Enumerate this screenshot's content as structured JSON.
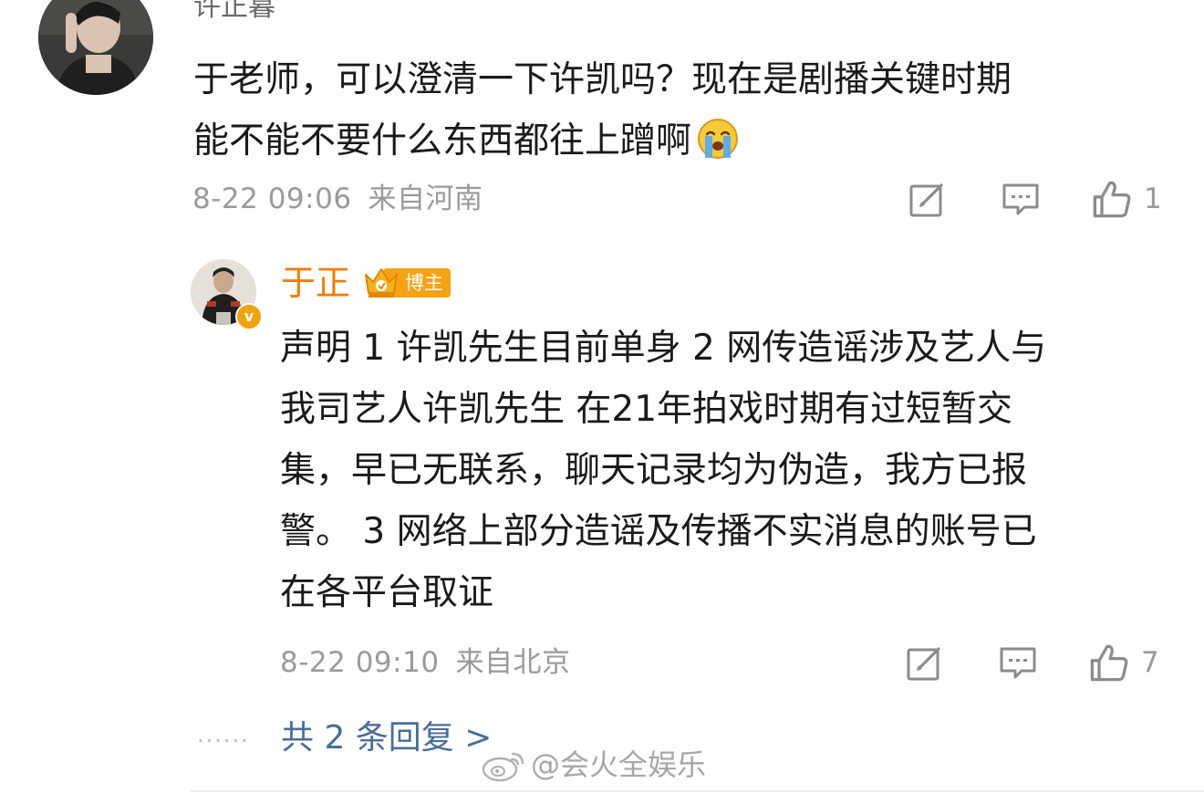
{
  "top_comment": {
    "username": "许正暮",
    "text_lines": [
      "于老师，可以澄清一下许凯吗？现在是剧播关键时期",
      "能不能不要什么东西都往上蹭啊"
    ],
    "date": "8-22 09:06",
    "location": "来自河南",
    "likes": "1"
  },
  "reply": {
    "username": "于正",
    "badge_label": "博主",
    "text_lines": [
      "声明 1 许凯先生目前单身 2 网传造谣涉及艺人与",
      "我司艺人许凯先生 在21年拍戏时期有过短暂交",
      "集，早已无联系，聊天记录均为伪造，我方已报",
      "警。 3 网络上部分造谣及传播不实消息的账号已",
      "在各平台取证"
    ],
    "date": "8-22 09:10",
    "location": "来自北京",
    "likes": "7"
  },
  "thread": {
    "dots": "......",
    "more_replies_label": "共 2 条回复 >"
  },
  "watermark": {
    "text": "@会火全娱乐"
  },
  "icons": {
    "share": "share-icon",
    "comment": "comment-icon",
    "like": "thumbs-up-icon",
    "crying": "crying-face-icon",
    "crown": "crown-icon",
    "verified": "verified-v-icon",
    "weibo": "weibo-logo-icon"
  },
  "colors": {
    "reply_name": "#f77b00",
    "host_badge": "#f5a213",
    "link_blue": "#4a6d9a",
    "meta_gray": "#9a9a9a"
  }
}
